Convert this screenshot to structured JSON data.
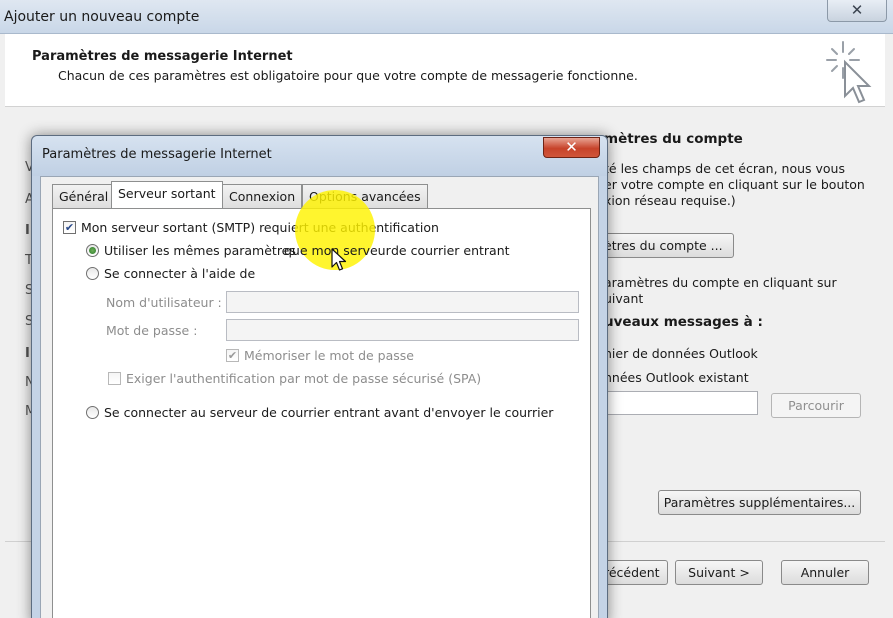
{
  "main_window": {
    "title": "Ajouter un nouveau compte",
    "close_glyph": "✕",
    "header": {
      "title": "Paramètres de messagerie Internet",
      "subtitle": "Chacun de ces paramètres est obligatoire pour que votre compte de messagerie fonctionne.",
      "icon": "wizard-cursor-icon"
    },
    "background": {
      "section_title": "mètres du compte",
      "desc_line1": "té les champs de cet écran, nous vous",
      "desc_line2": "er votre compte en cliquant sur le bouton",
      "desc_line3": "xion réseau requise.)",
      "test_button": "ètres du compte ...",
      "test_desc_line1": "aramètres du compte en cliquant sur",
      "test_desc_line2": "uivant",
      "deliver_title": "uveaux messages à :",
      "deliver_option1": "hier de données Outlook",
      "deliver_option2": "nnées Outlook existant",
      "browse_button": "Parcourir",
      "more_settings_button": "Paramètres supplémentaires...",
      "back_button": "récédent",
      "next_button": "Suivant >",
      "cancel_button": "Annuler",
      "left_fragments": [
        "V",
        "A",
        "I",
        "T",
        "S",
        "S",
        "I",
        "N",
        "M"
      ]
    }
  },
  "dialog": {
    "title": "Paramètres de messagerie Internet",
    "close_glyph": "✕",
    "tabs": [
      {
        "label": "Général",
        "active": false
      },
      {
        "label": "Serveur sortant",
        "active": true
      },
      {
        "label": "Connexion",
        "active": false
      },
      {
        "label": "Options avancées",
        "active": false
      }
    ],
    "outgoing": {
      "smtp_auth_label": "Mon serveur sortant (SMTP) requiert une authentification",
      "smtp_auth_checked": true,
      "same_settings_label_a": "Utiliser les mêmes paramètres ",
      "same_settings_label_b": "que mon serveur",
      "same_settings_label_c": " de courrier entrant",
      "same_settings_selected": true,
      "login_with_label": "Se connecter à l'aide de",
      "username_label": "Nom d'utilisateur :",
      "username_value": "",
      "password_label": "Mot de passe :",
      "password_value": "",
      "remember_password_label": "Mémoriser le mot de passe",
      "remember_password_checked": true,
      "spa_label": "Exiger l'authentification par mot de passe sécurisé (SPA)",
      "spa_checked": false,
      "login_before_label": "Se connecter au serveur de courrier entrant avant d'envoyer le courrier"
    }
  },
  "colors": {
    "highlight": "#fff300",
    "dialog_close": "#c7432a",
    "radio_dot": "#2a7a2a"
  }
}
